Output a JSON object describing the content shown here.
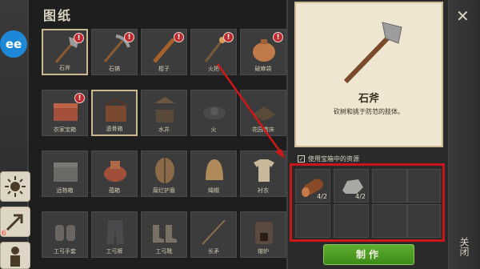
{
  "panel": {
    "title": "图纸"
  },
  "blueprints": [
    {
      "label": "石斧",
      "badge": "!"
    },
    {
      "label": "石镐",
      "badge": "!"
    },
    {
      "label": "棍子",
      "badge": "!"
    },
    {
      "label": "火把",
      "badge": "!"
    },
    {
      "label": "破麻袋",
      "badge": "!"
    },
    {
      "label": "农家宝箱",
      "badge": "!"
    },
    {
      "label": "遗骨箱",
      "badge": ""
    },
    {
      "label": "水井",
      "badge": ""
    },
    {
      "label": "火",
      "badge": ""
    },
    {
      "label": "花园苗床",
      "badge": ""
    },
    {
      "label": "远物箱",
      "badge": ""
    },
    {
      "label": "蕴箱",
      "badge": ""
    },
    {
      "label": "腐烂护盾",
      "badge": ""
    },
    {
      "label": "绳帽",
      "badge": ""
    },
    {
      "label": "衬衣",
      "badge": ""
    },
    {
      "label": "工弓手套",
      "badge": ""
    },
    {
      "label": "工弓裤",
      "badge": ""
    },
    {
      "label": "工弓靴",
      "badge": ""
    },
    {
      "label": "长矛",
      "badge": ""
    },
    {
      "label": "熔炉",
      "badge": ""
    }
  ],
  "sidebar": {
    "avatar": "ee",
    "notif_count": "6"
  },
  "detail": {
    "name": "石斧",
    "description": "砍树和挑于防范的肢体。"
  },
  "resources": {
    "use_chest_label": "使用宝箱中的资源",
    "checked": "✓",
    "items": [
      {
        "name": "wood-log-icon",
        "count": "4/2"
      },
      {
        "name": "stone-icon",
        "count": "4/2"
      }
    ]
  },
  "actions": {
    "craft": "制作",
    "close_x": "✕",
    "close_label": "关闭"
  },
  "colors": {
    "highlight_frame": "#c9161d",
    "badge": "#c0282c",
    "craft_button": "#4e9a24"
  }
}
